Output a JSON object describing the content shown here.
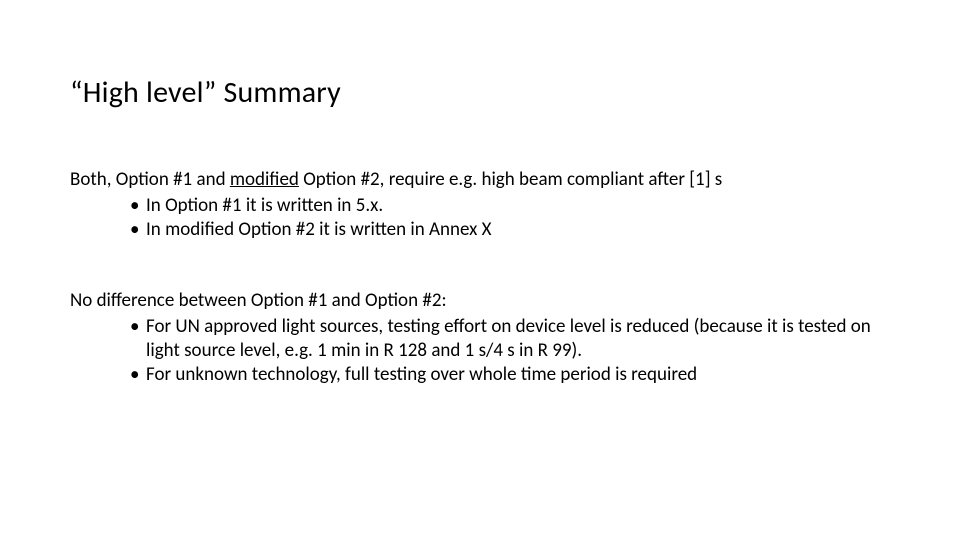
{
  "title": "“High level” Summary",
  "block1": {
    "intro_pre": "Both, Option #1 and ",
    "intro_underlined": "modified",
    "intro_post": " Option #2, require e.g. high beam compliant after [1] s",
    "bullets": [
      "In Option #1 it is written in 5.x.",
      "In modified Option #2 it is written in Annex X"
    ]
  },
  "block2": {
    "intro": "No difference between Option #1 and Option #2:",
    "bullets": [
      "For UN approved light sources, testing effort on device level is reduced (because it is tested on light source level, e.g. 1 min in R 128 and 1 s/4 s in R 99).",
      "For unknown technology, full testing over whole time period is required"
    ]
  }
}
